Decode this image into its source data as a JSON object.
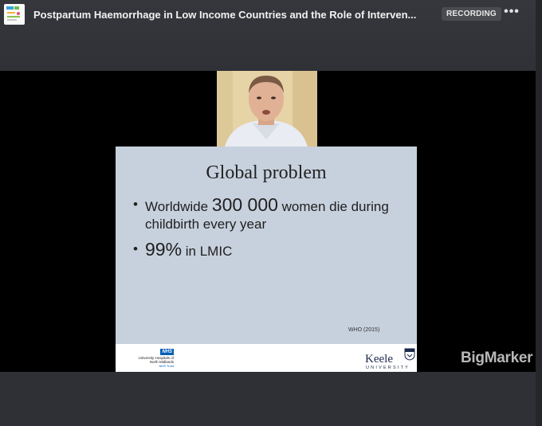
{
  "header": {
    "title": "Postpartum Haemorrhage in Low Income Countries and the Role of Interven...",
    "recording_label": "RECORDING",
    "more_icon": "more-horizontal-icon"
  },
  "slide": {
    "title": "Global problem",
    "bullet1": {
      "pre": "Worldwide ",
      "big": "300 000",
      "post": " women die during childbirth every year"
    },
    "bullet2": {
      "big": "99%",
      "post": " in LMIC"
    },
    "citation": "WHO (2015)",
    "nhs_badge": "NHS",
    "nhs_org": "University Hospitals of North Midlands",
    "nhs_trust": "NHS Trust",
    "keele_name": "Keele",
    "keele_sub": "UNIVERSITY"
  },
  "watermark": "BigMarker",
  "colors": {
    "slide_bg": "#c7d1dd",
    "nhs_blue": "#005eb8",
    "keele_navy": "#1c2a4a"
  }
}
